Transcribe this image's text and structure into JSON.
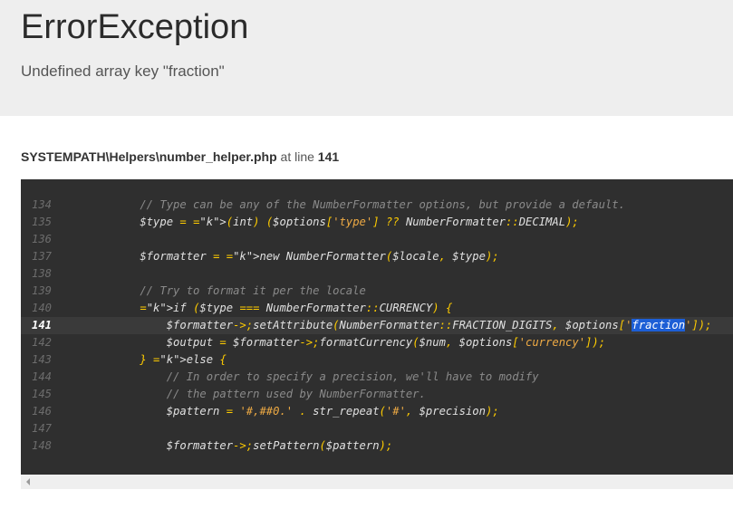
{
  "error": {
    "type": "ErrorException",
    "message": "Undefined array key \"fraction\""
  },
  "location": {
    "file": "SYSTEMPATH\\Helpers\\number_helper.php",
    "at_text": "at line",
    "line": "141"
  },
  "code": {
    "highlight_line": "141",
    "lines": [
      {
        "num": "134",
        "text": "    // Type can be any of the NumberFormatter options, but provide a default."
      },
      {
        "num": "135",
        "text": "    $type = (int) ($options['type'] ?? NumberFormatter::DECIMAL);"
      },
      {
        "num": "136",
        "text": ""
      },
      {
        "num": "137",
        "text": "    $formatter = new NumberFormatter($locale, $type);"
      },
      {
        "num": "138",
        "text": ""
      },
      {
        "num": "139",
        "text": "    // Try to format it per the locale"
      },
      {
        "num": "140",
        "text": "    if ($type === NumberFormatter::CURRENCY) {"
      },
      {
        "num": "141",
        "text": "        $formatter->setAttribute(NumberFormatter::FRACTION_DIGITS, $options['fraction']);"
      },
      {
        "num": "142",
        "text": "        $output = $formatter->formatCurrency($num, $options['currency']);"
      },
      {
        "num": "143",
        "text": "    } else {"
      },
      {
        "num": "144",
        "text": "        // In order to specify a precision, we'll have to modify"
      },
      {
        "num": "145",
        "text": "        // the pattern used by NumberFormatter."
      },
      {
        "num": "146",
        "text": "        $pattern = '#,##0.' . str_repeat('#', $precision);"
      },
      {
        "num": "147",
        "text": ""
      },
      {
        "num": "148",
        "text": "        $formatter->setPattern($pattern);"
      }
    ]
  },
  "colors": {
    "header_bg": "#eeeeee",
    "code_bg": "#2f2f2f",
    "selection": "#1d5fd6"
  }
}
